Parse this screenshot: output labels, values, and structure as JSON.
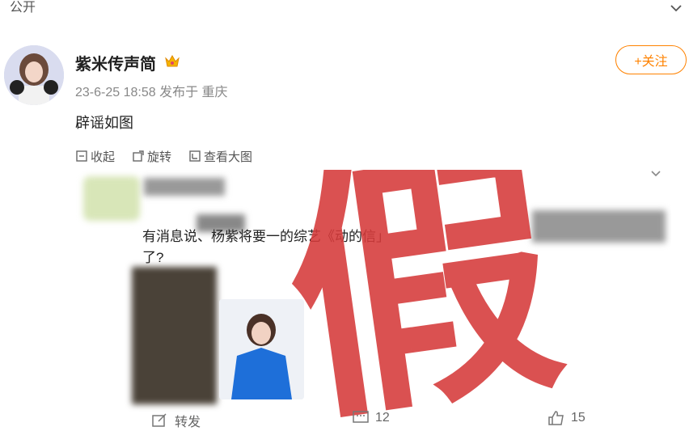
{
  "visibility": "公开",
  "author": {
    "name": "紫米传声简",
    "meta": "23-6-25 18:58 发布于 重庆"
  },
  "follow_label": "+关注",
  "post_text": "辟谣如图",
  "toolbar": {
    "collapse": "收起",
    "rotate": "旋转",
    "view_large": "查看大图"
  },
  "image": {
    "quote_line1": "有消息说、杨紫将要一的综艺《动的信」",
    "quote_line2": "了?",
    "stamp": "假",
    "repost_label": "转发",
    "comments": "12",
    "likes": "15"
  },
  "colors": {
    "accent": "#ff8200",
    "stamp": "#d63a3a"
  }
}
